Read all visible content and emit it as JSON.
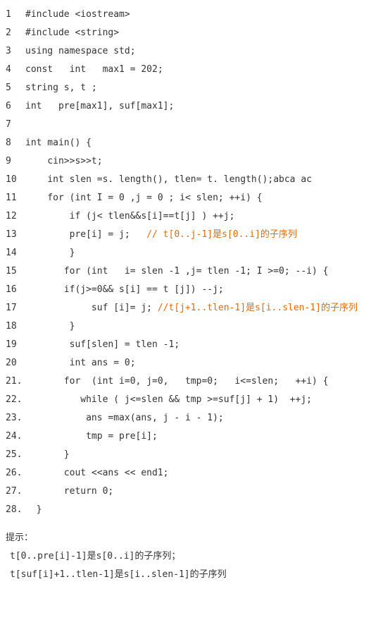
{
  "code": {
    "lines": [
      {
        "ln": "1",
        "pre": "#include <iostream>",
        "hl": ""
      },
      {
        "ln": "2",
        "pre": "#include <string>",
        "hl": ""
      },
      {
        "ln": "3",
        "pre": "using namespace std;",
        "hl": ""
      },
      {
        "ln": "4",
        "pre": "const   int   max1 = 202;",
        "hl": ""
      },
      {
        "ln": "5",
        "pre": "string s, t ;",
        "hl": ""
      },
      {
        "ln": "6",
        "pre": "int   pre[max1], suf[max1];",
        "hl": ""
      },
      {
        "ln": "7",
        "pre": "",
        "hl": ""
      },
      {
        "ln": "8",
        "pre": "int main() {",
        "hl": ""
      },
      {
        "ln": "9",
        "pre": "    cin>>s>>t;",
        "hl": ""
      },
      {
        "ln": "10",
        "pre": "    int slen =s. length(), tlen= t. length();abca ac",
        "hl": ""
      },
      {
        "ln": "11",
        "pre": "    for (int I = 0 ,j = 0 ; i< slen; ++i) {",
        "hl": ""
      },
      {
        "ln": "12",
        "pre": "        if (j< tlen&&s[i]==t[j] ) ++j;",
        "hl": ""
      },
      {
        "ln": "13",
        "pre": "        pre[i] = j;   ",
        "hl": "// t[0..j-1]是s[0..i]的子序列"
      },
      {
        "ln": "14",
        "pre": "        }",
        "hl": ""
      },
      {
        "ln": "15",
        "pre": "       for (int   i= slen -1 ,j= tlen -1; I >=0; --i) {",
        "hl": ""
      },
      {
        "ln": "16",
        "pre": "       if(j>=0&& s[i] == t [j]) --j;",
        "hl": ""
      },
      {
        "ln": "17",
        "pre": "            suf [i]= j; ",
        "hl": "//t[j+1..tlen-1]是s[i..slen-1]的子序列"
      },
      {
        "ln": "18",
        "pre": "        }",
        "hl": ""
      },
      {
        "ln": "19",
        "pre": "        suf[slen] = tlen -1;",
        "hl": ""
      },
      {
        "ln": "20",
        "pre": "        int ans = 0;",
        "hl": ""
      },
      {
        "ln": "21.",
        "pre": "       for  (int i=0, j=0,   tmp=0;   i<=slen;   ++i) {",
        "hl": ""
      },
      {
        "ln": "22.",
        "pre": "          while ( j<=slen && tmp >=suf[j] + 1)  ++j;",
        "hl": ""
      },
      {
        "ln": "23.",
        "pre": "           ans =max(ans, j - i - 1);",
        "hl": ""
      },
      {
        "ln": "24.",
        "pre": "           tmp = pre[i];",
        "hl": ""
      },
      {
        "ln": "25.",
        "pre": "       }",
        "hl": ""
      },
      {
        "ln": "26.",
        "pre": "       cout <<ans << end1;",
        "hl": ""
      },
      {
        "ln": "27.",
        "pre": "       return 0;",
        "hl": ""
      },
      {
        "ln": "28.",
        "pre": "  }",
        "hl": ""
      }
    ]
  },
  "hint": {
    "title": "提示：",
    "line1": "t[0..pre[i]-1]是s[0..i]的子序列；",
    "line2": "t[suf[i]+1..tlen-1]是s[i..slen-1]的子序列"
  }
}
